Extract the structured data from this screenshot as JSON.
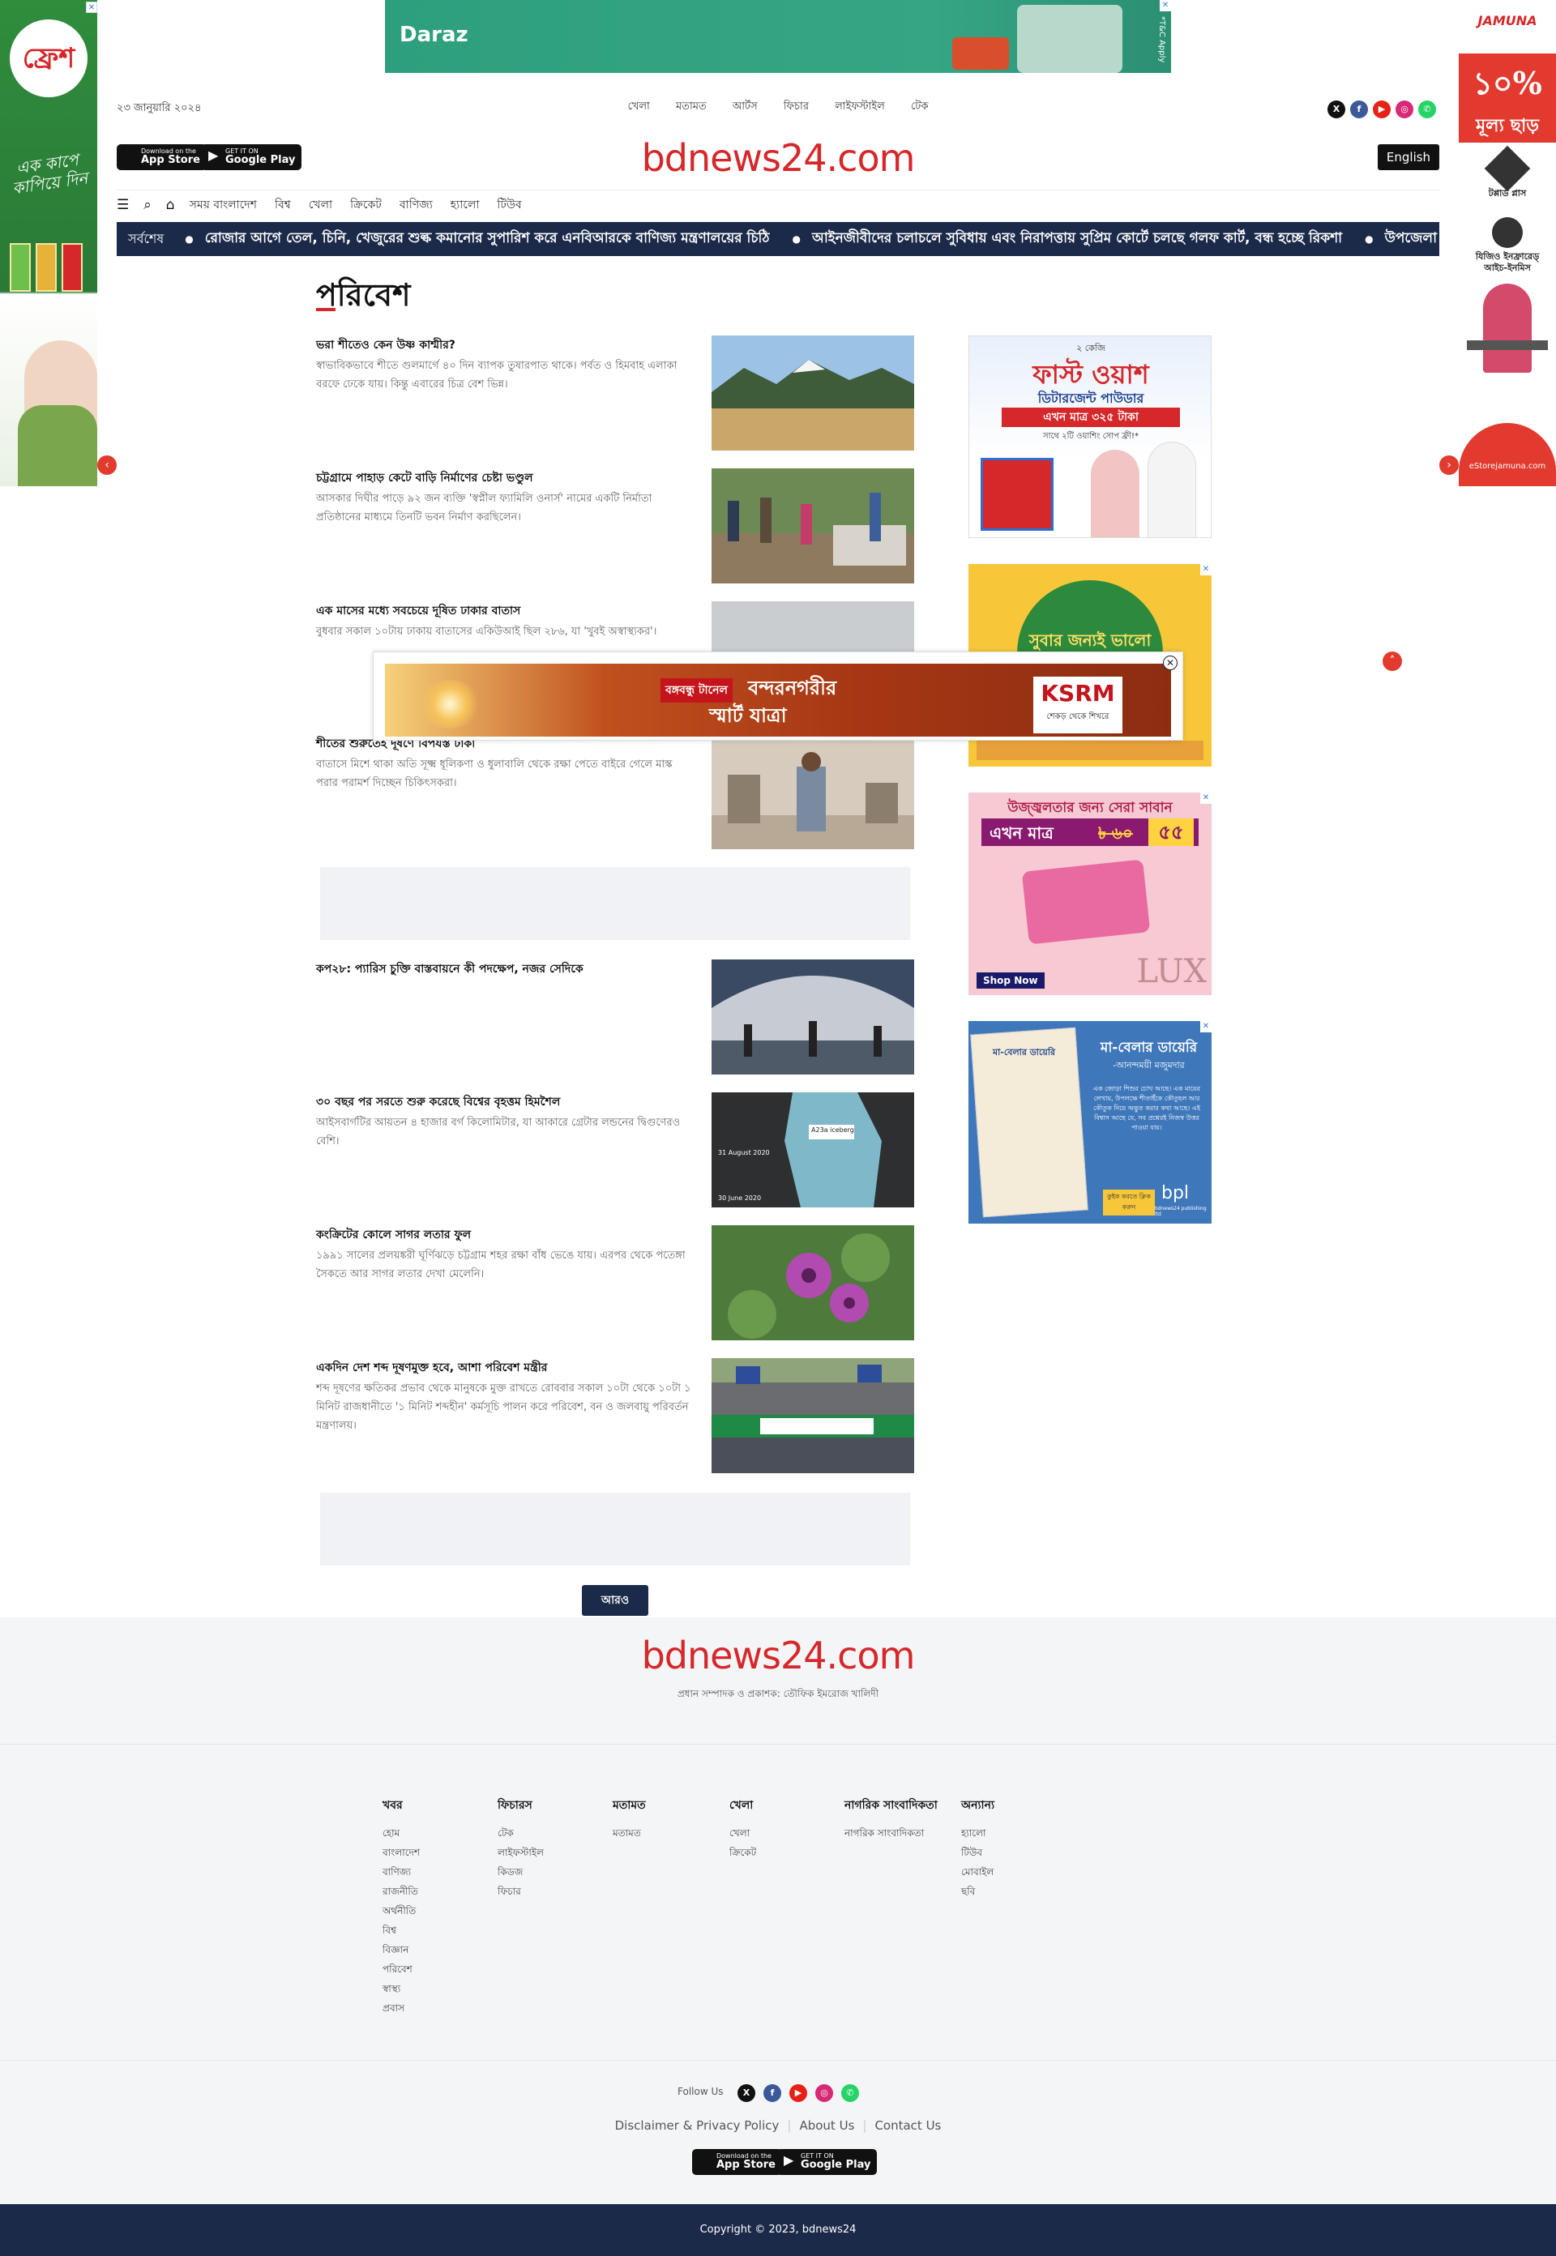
{
  "site": {
    "logo": "bdnews24.com",
    "date": "২৩ জানুয়ারি ২০২৪",
    "english_label": "English",
    "top_nav": [
      "খেলা",
      "মতামত",
      "আর্টস",
      "ফিচার",
      "লাইফস্টাইল",
      "টেক"
    ],
    "app_store": {
      "small": "Download on the",
      "big": "App Store"
    },
    "google_play": {
      "small": "GET IT ON",
      "big": "Google Play"
    }
  },
  "menu": {
    "items": [
      "সময় বাংলাদেশ",
      "বিশ্ব",
      "খেলা",
      "ক্রিকেট",
      "বাণিজ্য",
      "হ্যালো",
      "টিউব"
    ]
  },
  "ticker": {
    "label": "সর্বশেষ",
    "items": [
      "রোজার আগে তেল, চিনি, খেজুরের শুল্ক কমানোর সুপারিশ করে এনবিআরকে বাণিজ্য মন্ত্রণালয়ের চিঠি",
      "আইনজীবীদের চলাচলে সুবিধায় এবং নিরাপত্তায় সুপ্রিম কোর্টে চলছে গলফ কার্ট, বন্ধ হচ্ছে রিকশা",
      "উপজেলা পরিষদের ভোট ইভিএমে"
    ]
  },
  "section": {
    "title": "পরিবেশ"
  },
  "articles": [
    {
      "headline": "ভরা শীতেও কেন উষ্ণ কাশ্মীর?",
      "summary": "স্বাভাবিকভাবে শীতে গুলমার্গে ৪০ দিন ব্যাপক তুষারপাত থাকে। পর্বত ও হিমবাহ এলাকা বরফে ঢেকে যায়। কিন্তু এবারের চিত্র বেশ ভিন্ন।"
    },
    {
      "headline": "চট্টগ্রামে পাহাড় কেটে বাড়ি নির্মাণের চেষ্টা ভণ্ডুল",
      "summary": "আসকার দিঘীর পাড়ে ৯২ জন ব্যক্তি 'স্বপ্নীল ফ্যামিলি ওনার্স' নামের একটি নির্মাতা প্রতিষ্ঠানের মাধ্যমে তিনটি ভবন নির্মাণ করছিলেন।"
    },
    {
      "headline": "এক মাসের মধ্যে সবচেয়ে দূষিত ঢাকার বাতাস",
      "summary": "বুধবার সকাল ১০টায় ঢাকায় বাতাসের একিউআই ছিল ২৮৬, যা 'খুবই অস্বাস্থ্যকর'।"
    },
    {
      "headline": "শীতের শুরুতেই দূষণে বিপর্যস্ত ঢাকা",
      "summary": "বাতাসে মিশে থাকা অতি সূক্ষ্ম ধূলিকণা ও ধুলাবালি থেকে রক্ষা পেতে বাইরে গেলে মাস্ক পরার পরামর্শ দিচ্ছেন চিকিৎসকরা।"
    },
    {
      "headline": "কপ২৮: প্যারিস চুক্তি বাস্তবায়নে কী পদক্ষেপ, নজর সেদিকে",
      "summary": ""
    },
    {
      "headline": "৩০ বছর পর সরতে শুরু করেছে বিশ্বের বৃহত্তম হিমশৈল",
      "summary": "আইসবার্গটির আয়তন ৪ হাজার বর্গ কিলোমিটার, যা আকারে গ্রেটার লন্ডনের দ্বিগুণেরও বেশি।"
    },
    {
      "headline": "কংক্রিটের কোলে সাগর লতার ফুল",
      "summary": "১৯৯১ সালের প্রলয়ঙ্করী ঘূর্ণিঝড়ে চট্টগ্রাম শহর রক্ষা বাঁধ ভেঙে যায়। এরপর থেকে পতেঙ্গা সৈকতে আর সাগর লতার দেখা মেলেনি।"
    },
    {
      "headline": "একদিন দেশ শব্দ দূষণমুক্ত হবে, আশা পরিবেশ মন্ত্রীর",
      "summary": "শব্দ দূষণের ক্ষতিকর প্রভাব থেকে মানুষকে মুক্ত রাখতে রোববার সকাল ১০টা থেকে ১০টা ১ মিনিট রাজধানীতে '১ মিনিট শব্দহীন' কর্মসূচি পালন করে পরিবেশ, বন ও জলবায়ু পরিবর্তন মন্ত্রণালয়।"
    }
  ],
  "iceberg_labels": {
    "tag": "A23a iceberg",
    "date1": "31 August 2020",
    "date2": "30 June 2020"
  },
  "more_label": "আরও",
  "ads": {
    "top_banner": {
      "brand": "Daraz",
      "tc": "*T&C Apply"
    },
    "left_side": {
      "brand": "ফ্রেশ",
      "tagline": "এক কাপে কাপিয়ে দিন"
    },
    "right_side": {
      "brand": "JAMUNA",
      "offer_big": "১০%",
      "offer_small": "মূল্য ছাড়",
      "products": [
        "টপ্পার্ড প্লাস",
        "যিজিও ইনফ্রারেড্ আইচ-ইনমিস"
      ],
      "store": "eStorejamuna.com"
    },
    "overlay": {
      "tag": "বঙ্গবন্ধু টানেল",
      "line1": "বন্দরনগরীর",
      "line2": "স্মার্ট যাত্রা",
      "brand": "KSRM",
      "brand_sub": "শেকড় থেকে শিখরে"
    },
    "right_1": {
      "top": "২ কেজি",
      "title": "ফাস্ট ওয়াশ",
      "sub": "ডিটারজেন্ট পাউডার",
      "price": "এখন মাত্র ৩২৫ টাকা",
      "note": "সাথে ২টি ওয়াশিং সোপ ফ্রী!*"
    },
    "right_2": {
      "title": "সুবার জন্যই ভালো"
    },
    "right_3": {
      "title": "উজ্জ্বলতার জন্য সেরা সাবান",
      "price_prefix": "এখন মাত্র",
      "old_price": "৳ ৬০",
      "new_price": "৫৫",
      "brand": "LUX",
      "shop": "Shop Now"
    },
    "right_4": {
      "book": "মা-বেলার ডায়েরি",
      "title": "মা-বেলার ডায়েরি",
      "author": "-আনন্দময়ী মজুমদার",
      "desc": "এক জোড়া শিশুর চোখ আছে। এক মায়ের লেখায়, উপলক্ষে শীতাইঁকে কৌতূহল আর কৌতুক নিয়ে অদ্ভুত করার কথা আছে। এই বিশ্বাস আছে যে, সব প্রশ্নেরই নিজস্ব উত্তর পাওয়া যায়।",
      "cta": "কুইক করতে ক্লিক করুন",
      "brand": "bpl",
      "brand_sub": "bdnews24 publishing ltd"
    }
  },
  "footer": {
    "logo": "bdnews24.com",
    "editor": "প্রধান সম্পাদক ও প্রকাশক: তৌফিক ইমরোজ খালিদী",
    "columns": [
      {
        "title": "খবর",
        "links": [
          "হোম",
          "বাংলাদেশ",
          "বাণিজ্য",
          "রাজনীতি",
          "অর্থনীতি",
          "বিশ্ব",
          "বিজ্ঞান",
          "পরিবেশ",
          "স্বাস্থ্য",
          "প্রবাস"
        ]
      },
      {
        "title": "ফিচারস",
        "links": [
          "টেক",
          "লাইফস্টাইল",
          "কিডজ",
          "ফিচার"
        ]
      },
      {
        "title": "মতামত",
        "links": [
          "মতামত"
        ]
      },
      {
        "title": "খেলা",
        "links": [
          "খেলা",
          "ক্রিকেট"
        ]
      },
      {
        "title": "নাগরিক সাংবাদিকতা",
        "links": [
          "নাগরিক সাংবাদিকতা"
        ]
      },
      {
        "title": "অন্যান্য",
        "links": [
          "হ্যালো",
          "টিউব",
          "মোবাইল",
          "ছবি"
        ]
      }
    ],
    "follow_label": "Follow Us",
    "policy": [
      "Disclaimer & Privacy Policy",
      "About Us",
      "Contact Us"
    ],
    "copyright": "Copyright © 2023, bdnews24"
  },
  "colors": {
    "accent": "#d6272a",
    "navy": "#1c2a4a",
    "footer_bg": "#f4f5f7"
  }
}
